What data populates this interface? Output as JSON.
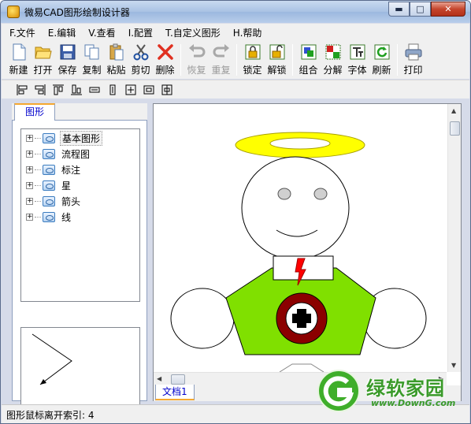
{
  "window": {
    "title": "微易CAD图形绘制设计器",
    "controls": {
      "minimize": "▬",
      "maximize": "□",
      "close": "✕"
    }
  },
  "menu": [
    {
      "label": "F.文件"
    },
    {
      "label": "E.编辑"
    },
    {
      "label": "V.查看"
    },
    {
      "label": "I.配置"
    },
    {
      "label": "T.自定义图形"
    },
    {
      "label": "H.帮助"
    }
  ],
  "toolbar": {
    "new": "新建",
    "open": "打开",
    "save": "保存",
    "copy": "复制",
    "paste": "粘贴",
    "cut": "剪切",
    "delete": "删除",
    "undo": "恢复",
    "redo": "重复",
    "lock": "锁定",
    "unlock": "解锁",
    "group": "组合",
    "ungroup": "分解",
    "font": "字体",
    "refresh": "刷新",
    "print": "打印"
  },
  "left_panel": {
    "tab": "图形",
    "tree": [
      {
        "label": "基本图形",
        "expander": "+"
      },
      {
        "label": "流程图",
        "expander": "+"
      },
      {
        "label": "标注",
        "expander": "+"
      },
      {
        "label": "星",
        "expander": "+"
      },
      {
        "label": "箭头",
        "expander": "+"
      },
      {
        "label": "线",
        "expander": "+"
      }
    ]
  },
  "canvas": {
    "doc_tab": "文档1"
  },
  "status": {
    "text": "图形鼠标离开索引: 4"
  },
  "watermark": {
    "name": "绿软家园",
    "url": "www.DownG.com"
  },
  "colors": {
    "halo": "#ffff00",
    "body": "#80e000",
    "emblem_ring": "#8b0000",
    "tie": "#ff0000",
    "watermark_green": "#3a9a2a"
  }
}
